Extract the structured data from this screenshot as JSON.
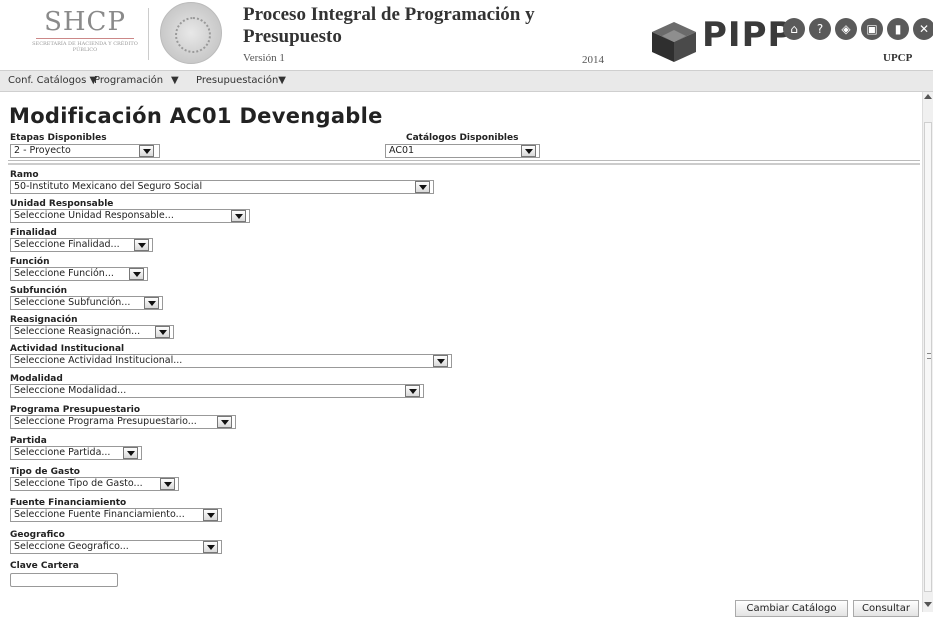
{
  "header": {
    "logo_text": "SHCP",
    "logo_subtitle": "SECRETARÍA DE HACIENDA Y CRÉDITO PÚBLICO",
    "title_line1": "Proceso Integral de Programación y",
    "title_line2": "Presupuesto",
    "version": "Versión 1",
    "year": "2014",
    "brand": "PIPP",
    "user_area": "UPCP",
    "icons": [
      "home-icon",
      "help-icon",
      "layers-icon",
      "window-icon",
      "book-icon",
      "close-icon"
    ]
  },
  "menu": {
    "items": [
      {
        "label": "Conf. Catálogos ▼"
      },
      {
        "label": "Programación"
      },
      {
        "label": "▼"
      },
      {
        "label": "Presupuestación▼"
      }
    ]
  },
  "page": {
    "title": "Modificación AC01 Devengable",
    "etapas_label": "Etapas Disponibles",
    "etapas_value": "2 - Proyecto",
    "catalogos_label": "Catálogos Disponibles",
    "catalogos_value": "AC01"
  },
  "form": {
    "fields": [
      {
        "label": "Ramo",
        "value": "50-Instituto Mexicano del Seguro Social"
      },
      {
        "label": "Unidad Responsable",
        "value": "Seleccione Unidad Responsable..."
      },
      {
        "label": "Finalidad",
        "value": "Seleccione Finalidad..."
      },
      {
        "label": "Función",
        "value": "Seleccione Función..."
      },
      {
        "label": "Subfunción",
        "value": "Seleccione Subfunción..."
      },
      {
        "label": "Reasignación",
        "value": "Seleccione Reasignación..."
      },
      {
        "label": "Actividad Institucional",
        "value": "Seleccione Actividad Institucional..."
      },
      {
        "label": "Modalidad",
        "value": "Seleccione Modalidad..."
      },
      {
        "label": "Programa Presupuestario",
        "value": "Seleccione Programa Presupuestario..."
      },
      {
        "label": "Partida",
        "value": "Seleccione Partida..."
      },
      {
        "label": "Tipo de Gasto",
        "value": "Seleccione Tipo de Gasto..."
      },
      {
        "label": "Fuente Financiamiento",
        "value": "Seleccione Fuente Financiamiento..."
      },
      {
        "label": "Geografico",
        "value": "Seleccione Geografico..."
      }
    ],
    "clave_label": "Clave Cartera",
    "clave_value": ""
  },
  "buttons": {
    "cambiar": "Cambiar Catálogo",
    "consultar": "Consultar"
  },
  "colors": {
    "menu_bg": "#e9e9e9",
    "brand_dark": "#3a3a3a"
  }
}
